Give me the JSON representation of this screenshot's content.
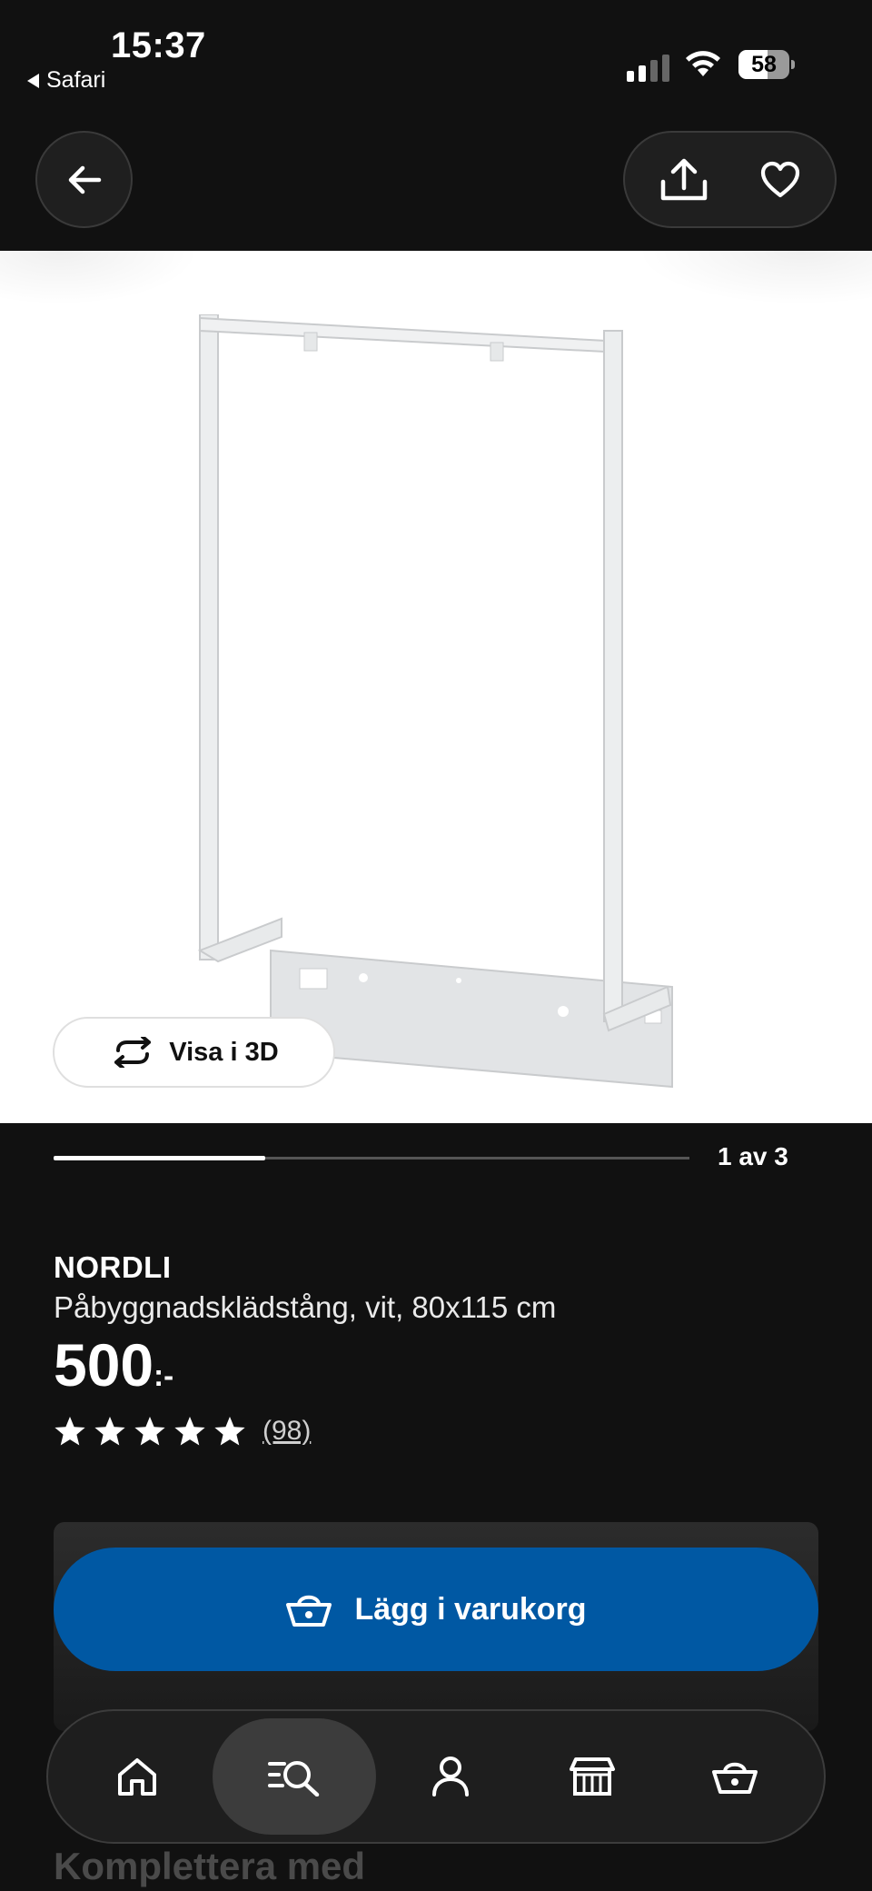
{
  "status_bar": {
    "time": "15:37",
    "back_app": "Safari",
    "battery": "58",
    "battery_level": 0.58,
    "signal_bars_active": 2,
    "signal_bars_total": 4
  },
  "top_nav": {
    "back_icon": "arrow-left-icon",
    "share_icon": "share-icon",
    "favorite_icon": "heart-icon"
  },
  "gallery": {
    "view_3d_label": "Visa i 3D",
    "view_3d_icon": "rotate-icon",
    "position_label": "1 av 3",
    "current": 1,
    "total": 3
  },
  "product": {
    "brand": "NORDLI",
    "description": "Påbyggnadsklädstång, vit, 80x115 cm",
    "price_amount": "500",
    "price_suffix": ":-",
    "rating_stars": 5,
    "rating_max": 5,
    "review_count": "(98)"
  },
  "cart": {
    "add_label": "Lägg i varukorg",
    "icon": "basket-icon",
    "button_color": "#0058a3"
  },
  "sections": {
    "complement_title": "Komplettera med"
  },
  "tabbar": {
    "items": [
      {
        "name": "home",
        "icon": "home-icon",
        "active": false
      },
      {
        "name": "search",
        "icon": "search-list-icon",
        "active": true
      },
      {
        "name": "profile",
        "icon": "person-icon",
        "active": false
      },
      {
        "name": "store",
        "icon": "store-icon",
        "active": false
      },
      {
        "name": "cart",
        "icon": "basket-icon",
        "active": false
      }
    ]
  }
}
